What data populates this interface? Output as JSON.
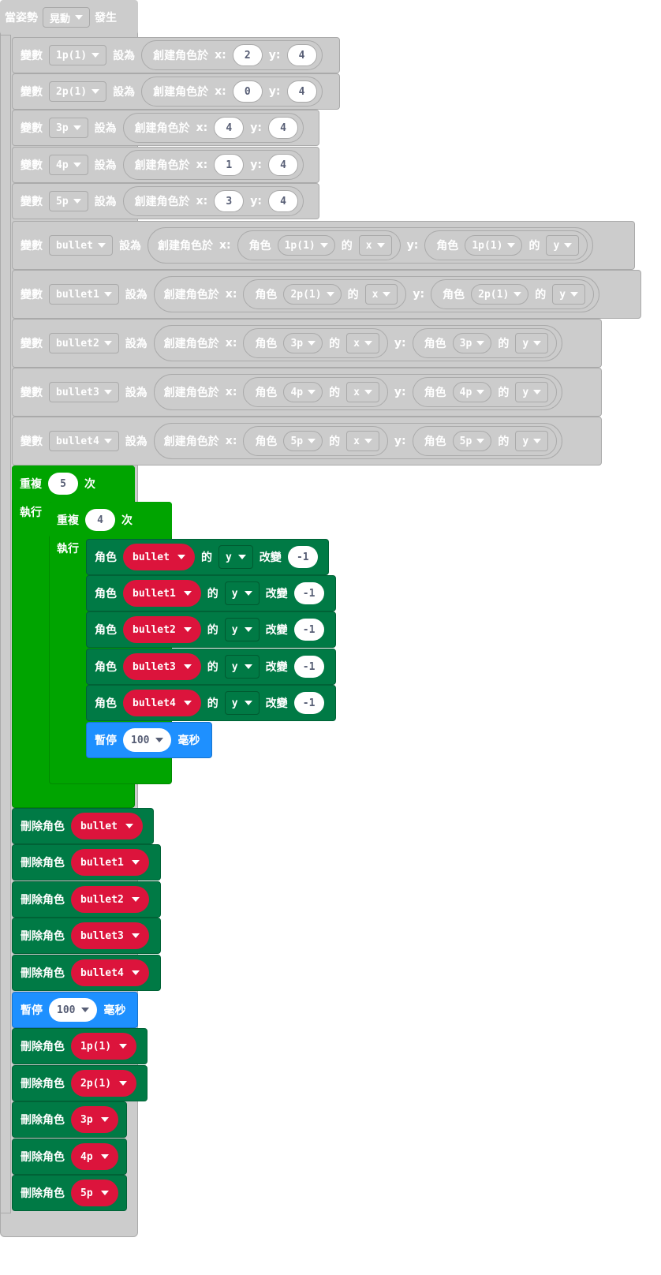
{
  "hat": {
    "prefix": "當姿勢",
    "gesture": "晃動",
    "suffix": "發生"
  },
  "labels": {
    "var": "變數",
    "set_to": "設為",
    "create_at": "創建角色於",
    "x": "x:",
    "y": "y:",
    "sprite": "角色",
    "of": "的",
    "change": "改變",
    "repeat": "重複",
    "times": "次",
    "do": "執行",
    "pause": "暫停",
    "ms": "毫秒",
    "delete": "刪除角色"
  },
  "assign_simple": [
    {
      "var": "1p(1)",
      "x": "2",
      "y": "4"
    },
    {
      "var": "2p(1)",
      "x": "0",
      "y": "4"
    },
    {
      "var": "3p",
      "x": "4",
      "y": "4"
    },
    {
      "var": "4p",
      "x": "1",
      "y": "4"
    },
    {
      "var": "5p",
      "x": "3",
      "y": "4"
    }
  ],
  "assign_bullets": [
    {
      "var": "bullet",
      "src": "1p(1)",
      "xprop": "x",
      "yprop": "y"
    },
    {
      "var": "bullet1",
      "src": "2p(1)",
      "xprop": "x",
      "yprop": "y"
    },
    {
      "var": "bullet2",
      "src": "3p",
      "xprop": "x",
      "yprop": "y"
    },
    {
      "var": "bullet3",
      "src": "4p",
      "xprop": "x",
      "yprop": "y"
    },
    {
      "var": "bullet4",
      "src": "5p",
      "xprop": "x",
      "yprop": "y"
    }
  ],
  "outer_repeat": "5",
  "inner_repeat": "4",
  "change_blocks": [
    {
      "sprite": "bullet",
      "prop": "y",
      "value": "-1"
    },
    {
      "sprite": "bullet1",
      "prop": "y",
      "value": "-1"
    },
    {
      "sprite": "bullet2",
      "prop": "y",
      "value": "-1"
    },
    {
      "sprite": "bullet3",
      "prop": "y",
      "value": "-1"
    },
    {
      "sprite": "bullet4",
      "prop": "y",
      "value": "-1"
    }
  ],
  "pause_inner": "100",
  "delete_bullets": [
    "bullet",
    "bullet1",
    "bullet2",
    "bullet3",
    "bullet4"
  ],
  "pause_outer": "100",
  "delete_players": [
    "1p(1)",
    "2p(1)",
    "3p",
    "4p",
    "5p"
  ]
}
